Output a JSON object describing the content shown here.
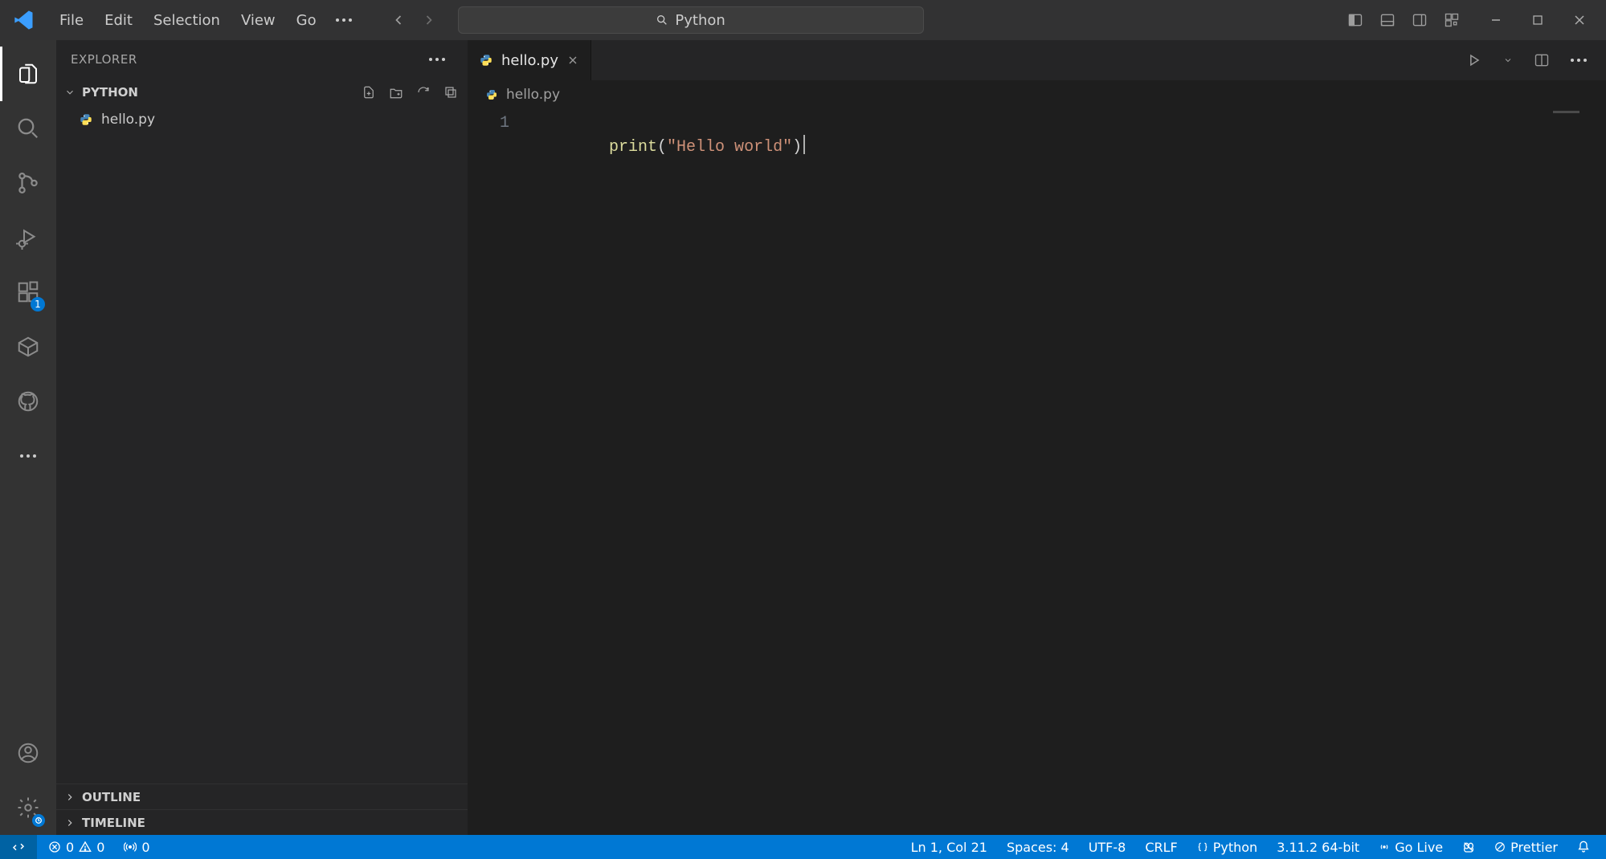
{
  "menu": {
    "file": "File",
    "edit": "Edit",
    "selection": "Selection",
    "view": "View",
    "go": "Go"
  },
  "search": {
    "placeholder": "Python"
  },
  "activity": {
    "extensions_badge": "1"
  },
  "sidebar": {
    "title": "EXPLORER",
    "folder": "PYTHON",
    "files": [
      "hello.py"
    ],
    "panels": [
      "OUTLINE",
      "TIMELINE"
    ]
  },
  "editor": {
    "tab_name": "hello.py",
    "breadcrumb": "hello.py",
    "code": {
      "line_number": "1",
      "fn": "print",
      "open_paren": "(",
      "string": "\"Hello world\"",
      "close_paren": ")"
    }
  },
  "status": {
    "errors": "0",
    "warnings": "0",
    "ports": "0",
    "ln_col": "Ln 1, Col 21",
    "indent": "Spaces: 4",
    "encoding": "UTF-8",
    "eol": "CRLF",
    "language": "Python",
    "interpreter": "3.11.2 64-bit",
    "go_live": "Go Live",
    "prettier": "Prettier"
  }
}
